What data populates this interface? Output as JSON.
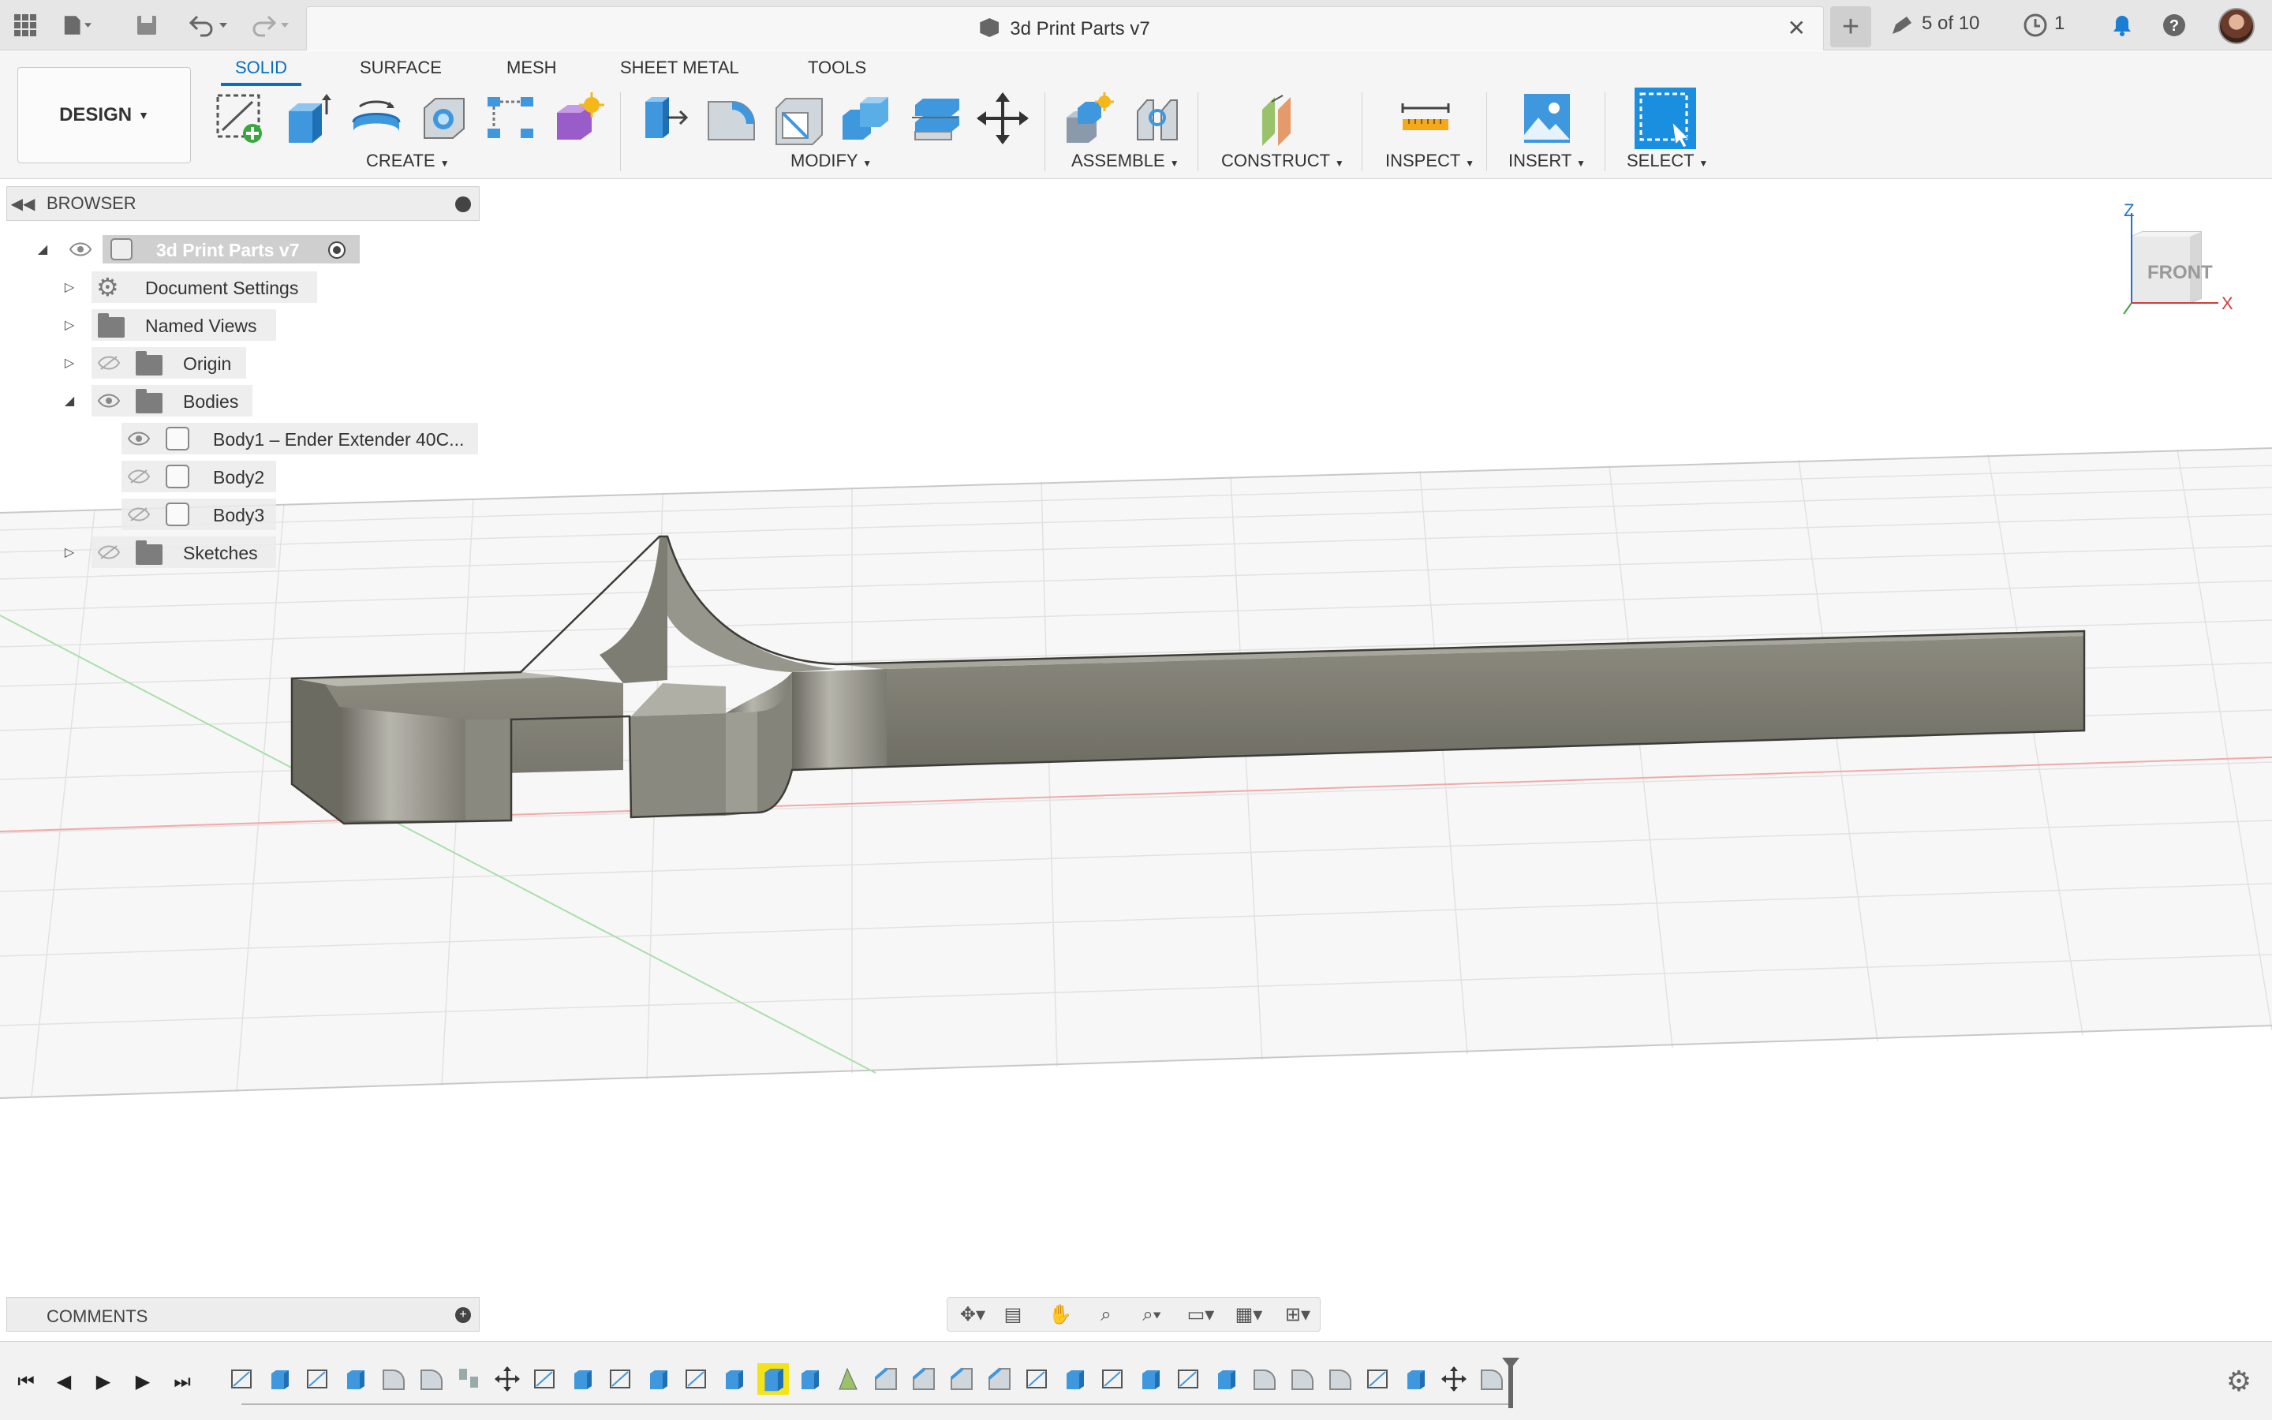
{
  "titlebar": {
    "doc_title": "3d Print Parts v7",
    "version_count": "5 of 10",
    "jobs_count": "1"
  },
  "ribbon": {
    "design_label": "DESIGN",
    "tabs": [
      {
        "label": "SOLID",
        "active": true
      },
      {
        "label": "SURFACE",
        "active": false
      },
      {
        "label": "MESH",
        "active": false
      },
      {
        "label": "SHEET METAL",
        "active": false
      },
      {
        "label": "TOOLS",
        "active": false
      }
    ],
    "groups": {
      "create": "CREATE",
      "modify": "MODIFY",
      "assemble": "ASSEMBLE",
      "construct": "CONSTRUCT",
      "inspect": "INSPECT",
      "insert": "INSERT",
      "select": "SELECT"
    }
  },
  "browser": {
    "title": "BROWSER",
    "root": "3d Print Parts v7",
    "items": [
      {
        "label": "Document Settings"
      },
      {
        "label": "Named Views"
      },
      {
        "label": "Origin"
      },
      {
        "label": "Bodies"
      },
      {
        "label": "Body1 – Ender Extender 40C..."
      },
      {
        "label": "Body2"
      },
      {
        "label": "Body3"
      },
      {
        "label": "Sketches"
      }
    ]
  },
  "viewcube": {
    "face": "FRONT",
    "axis_z": "Z",
    "axis_x": "X"
  },
  "comments": {
    "title": "COMMENTS"
  },
  "colors": {
    "accent": "#0a6fc2",
    "part_body": "#86857a",
    "select_blue": "#1a8fe0",
    "timeline_current": "#f5e31a"
  }
}
